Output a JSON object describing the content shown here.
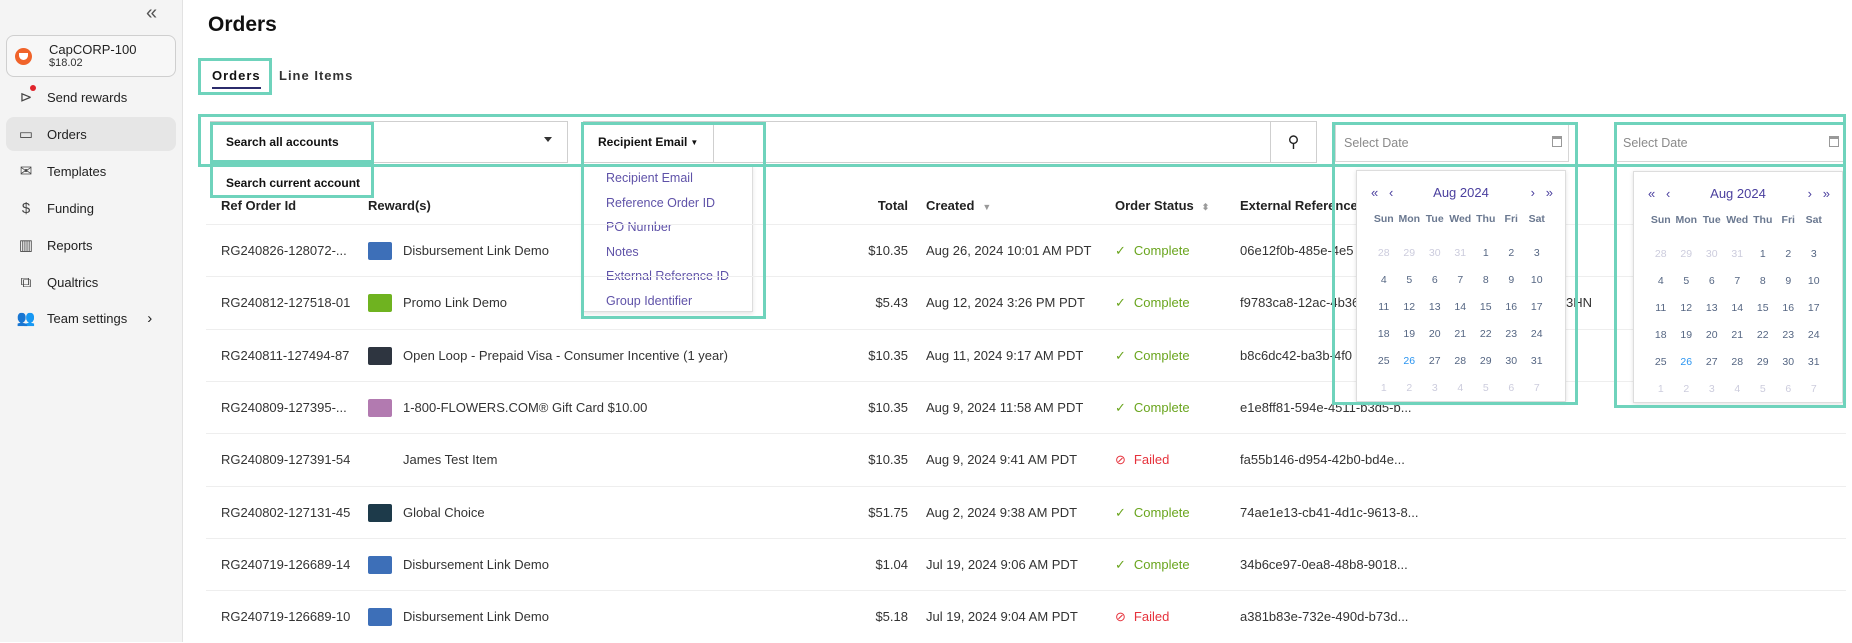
{
  "sidebar": {
    "collapse_icon": "double-chevron-left",
    "account": {
      "name": "CapCORP-100",
      "balance": "$18.02"
    },
    "items": [
      {
        "label": "Send rewards",
        "icon": "send-icon"
      },
      {
        "label": "Orders",
        "icon": "folder-icon",
        "active": true
      },
      {
        "label": "Templates",
        "icon": "mail-icon"
      },
      {
        "label": "Funding",
        "icon": "dollar-icon"
      },
      {
        "label": "Reports",
        "icon": "chart-icon"
      },
      {
        "label": "Qualtrics",
        "icon": "qualtrics-icon"
      },
      {
        "label": "Team settings",
        "icon": "team-icon",
        "chevron": true
      }
    ]
  },
  "page": {
    "title": "Orders"
  },
  "tabs": [
    {
      "label": "Orders",
      "active": true
    },
    {
      "label": "Line Items"
    }
  ],
  "filters": {
    "account_scope": {
      "selected": "Search all accounts",
      "options": [
        "Search current account"
      ]
    },
    "search_field": {
      "selected": "Recipient Email",
      "options": [
        "Recipient Email",
        "Reference Order ID",
        "PO Number",
        "Notes",
        "External Reference ID",
        "Group Identifier"
      ],
      "value": ""
    },
    "date_from": {
      "placeholder": "Select Date"
    },
    "date_to": {
      "placeholder": "Select Date"
    }
  },
  "calendar": {
    "month_label": "Aug 2024",
    "weekdays": [
      "Sun",
      "Mon",
      "Tue",
      "Wed",
      "Thu",
      "Fri",
      "Sat"
    ],
    "days": [
      "28",
      "29",
      "30",
      "31",
      "1",
      "2",
      "3",
      "4",
      "5",
      "6",
      "7",
      "8",
      "9",
      "10",
      "11",
      "12",
      "13",
      "14",
      "15",
      "16",
      "17",
      "18",
      "19",
      "20",
      "21",
      "22",
      "23",
      "24",
      "25",
      "26",
      "27",
      "28",
      "29",
      "30",
      "31",
      "1",
      "2",
      "3",
      "4",
      "5",
      "6",
      "7"
    ],
    "today": "26",
    "nav": {
      "prev_year": "«",
      "prev_month": "‹",
      "next_month": "›",
      "next_year": "»"
    }
  },
  "table": {
    "headers": {
      "ref": "Ref Order Id",
      "reward": "Reward(s)",
      "total": "Total",
      "created": "Created",
      "status": "Order Status",
      "external": "External Reference"
    },
    "rows": [
      {
        "ref": "RG240826-128072-...",
        "reward": "Disbursement Link Demo",
        "thumb": "#3d6fb8",
        "total": "$10.35",
        "created": "Aug 26, 2024 10:01 AM PDT",
        "status": "Complete",
        "external": "06e12f0b-485e-4e5"
      },
      {
        "ref": "RG240812-127518-01",
        "reward": "Promo Link Demo",
        "thumb": "#6fb320",
        "total": "$5.43",
        "created": "Aug 12, 2024 3:26 PM PDT",
        "status": "Complete",
        "external": "f9783ca8-12ac-4b36",
        "extra": "3HN"
      },
      {
        "ref": "RG240811-127494-87",
        "reward": "Open Loop - Prepaid Visa - Consumer Incentive (1 year)",
        "thumb": "#2e3540",
        "total": "$10.35",
        "created": "Aug 11, 2024 9:17 AM PDT",
        "status": "Complete",
        "external": "b8c6dc42-ba3b-4f0"
      },
      {
        "ref": "RG240809-127395-...",
        "reward": "1-800-FLOWERS.COM® Gift Card $10.00",
        "thumb": "#b27ab0",
        "total": "$10.35",
        "created": "Aug 9, 2024 11:58 AM PDT",
        "status": "Complete",
        "external": "e1e8ff81-594e-4511-b3d5-b..."
      },
      {
        "ref": "RG240809-127391-54",
        "reward": "James Test Item",
        "thumb": "",
        "total": "$10.35",
        "created": "Aug 9, 2024 9:41 AM PDT",
        "status": "Failed",
        "external": "fa55b146-d954-42b0-bd4e..."
      },
      {
        "ref": "RG240802-127131-45",
        "reward": "Global Choice",
        "thumb": "#1d3a4a",
        "total": "$51.75",
        "created": "Aug 2, 2024 9:38 AM PDT",
        "status": "Complete",
        "external": "74ae1e13-cb41-4d1c-9613-8..."
      },
      {
        "ref": "RG240719-126689-14",
        "reward": "Disbursement Link Demo",
        "thumb": "#3d6fb8",
        "total": "$1.04",
        "created": "Jul 19, 2024 9:06 AM PDT",
        "status": "Complete",
        "external": "34b6ce97-0ea8-48b8-9018..."
      },
      {
        "ref": "RG240719-126689-10",
        "reward": "Disbursement Link Demo",
        "thumb": "#3d6fb8",
        "total": "$5.18",
        "created": "Jul 19, 2024 9:04 AM PDT",
        "status": "Failed",
        "external": "a381b83e-732e-490d-b73d..."
      }
    ]
  },
  "colors": {
    "highlight": "#6fd3bc",
    "complete": "#6aa51e",
    "failed": "#e6323c",
    "link": "#5f52a8",
    "today": "#2a94f0"
  }
}
